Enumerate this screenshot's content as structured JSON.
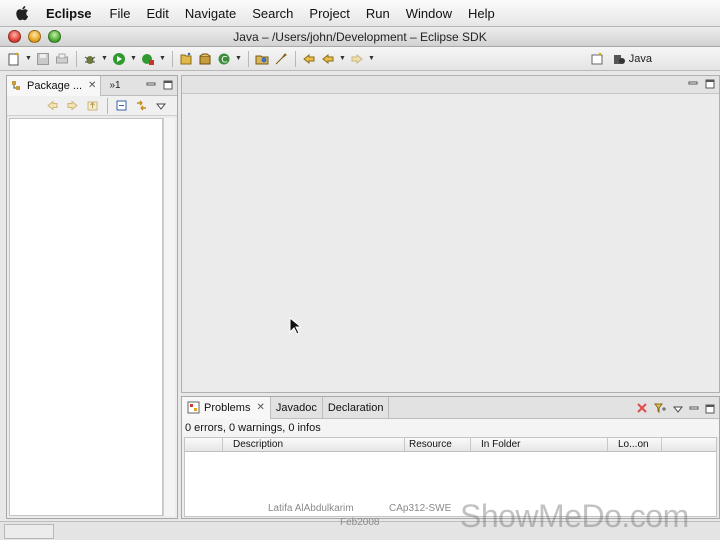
{
  "menubar": {
    "app_name": "Eclipse",
    "items": [
      "File",
      "Edit",
      "Navigate",
      "Search",
      "Project",
      "Run",
      "Window",
      "Help"
    ]
  },
  "window": {
    "title": "Java – /Users/john/Development – Eclipse SDK"
  },
  "toolbar": {
    "perspective_label": "Java"
  },
  "package_explorer": {
    "tab_label": "Package ...",
    "close_glyph": "✕",
    "secondary_tab_label": "»1"
  },
  "bottom_panel": {
    "tabs": [
      {
        "label": "Problems",
        "close": "✕"
      },
      {
        "label": "Javadoc"
      },
      {
        "label": "Declaration"
      }
    ],
    "summary": "0 errors, 0 warnings, 0 infos",
    "columns": [
      "",
      "Description",
      "Resource",
      "In Folder",
      "Lo...on"
    ]
  },
  "footer": {
    "author": "Latifa AlAbdulkarim",
    "course": "CAp312-SWE",
    "date": "Feb2008",
    "watermark": "ShowMeDo.com"
  },
  "colors": {
    "menubar_bg": "#f0f0f0",
    "workspace_bg": "#ebebeb",
    "view_bg": "#ffffff"
  }
}
